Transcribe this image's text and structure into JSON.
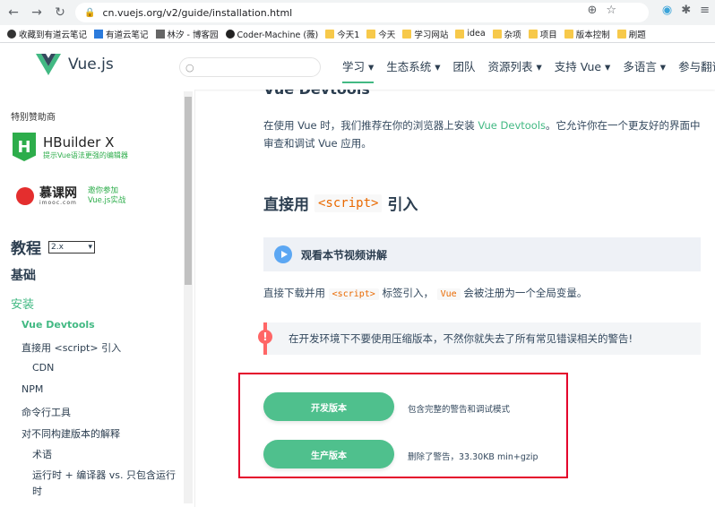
{
  "browser": {
    "url": "cn.vuejs.org/v2/guide/installation.html",
    "bookmarks": [
      {
        "label": "收藏到有道云笔记"
      },
      {
        "label": "有道云笔记"
      },
      {
        "label": "林汐 - 博客园"
      },
      {
        "label": "Coder-Machine (薇)"
      },
      {
        "label": "今天1"
      },
      {
        "label": "今天"
      },
      {
        "label": "学习网站"
      },
      {
        "label": "idea"
      },
      {
        "label": "杂项"
      },
      {
        "label": "项目"
      },
      {
        "label": "版本控制"
      },
      {
        "label": "刷题"
      }
    ]
  },
  "header": {
    "logo_text": "Vue.js",
    "nav": [
      {
        "label": "学习 ▾"
      },
      {
        "label": "生态系统 ▾"
      },
      {
        "label": "团队"
      },
      {
        "label": "资源列表 ▾"
      },
      {
        "label": "支持 Vue ▾"
      },
      {
        "label": "多语言 ▾"
      },
      {
        "label": "参与翻译"
      }
    ]
  },
  "sidebar": {
    "sponsor_label": "特别赞助商",
    "hbuilder_logo": "H",
    "hbuilder_title": "HBuilder X",
    "hbuilder_sub": "提示Vue语法更强的编辑器",
    "imooc_name": "慕课网",
    "imooc_url": "imooc.com",
    "imooc_promo_1": "邀你参加",
    "imooc_promo_2": "Vue.js实战",
    "version_title": "教程",
    "version_value": "2.x",
    "section_basic": "基础",
    "section_install": "安装",
    "items": [
      {
        "label": "Vue Devtools"
      },
      {
        "label": "直接用 <script> 引入"
      },
      {
        "label": "CDN"
      },
      {
        "label": "NPM"
      },
      {
        "label": "命令行工具"
      },
      {
        "label": "对不同构建版本的解释"
      },
      {
        "label": "术语"
      },
      {
        "label": "运行时 + 编译器 vs. 只包含运行"
      },
      {
        "label": "时"
      }
    ]
  },
  "main": {
    "clipped_heading": "Vue Devtools",
    "devtools_para_1": "在使用 Vue 时，我们推荐在你的浏览器上安装 ",
    "devtools_link": "Vue Devtools",
    "devtools_para_2": "。它允许你在一个更友好的界面中",
    "devtools_para_3": "审查和调试 Vue 应用。",
    "h2_prefix": "直接用",
    "h2_code": "<script>",
    "h2_suffix": "引入",
    "video_text": "观看本节视频讲解",
    "direct_para_1": "直接下载并用",
    "direct_code_1": "<script>",
    "direct_para_2": "标签引入，",
    "direct_code_2": "Vue",
    "direct_para_3": "会被注册为一个全局变量。",
    "warning_icon": "!",
    "warning_text": "在开发环境下不要使用压缩版本，不然你就失去了所有常见错误相关的警告!",
    "dev_button": "开发版本",
    "dev_desc": "包含完整的警告和调试模式",
    "prod_button": "生产版本",
    "prod_desc": "删除了警告，33.30KB min+gzip"
  }
}
